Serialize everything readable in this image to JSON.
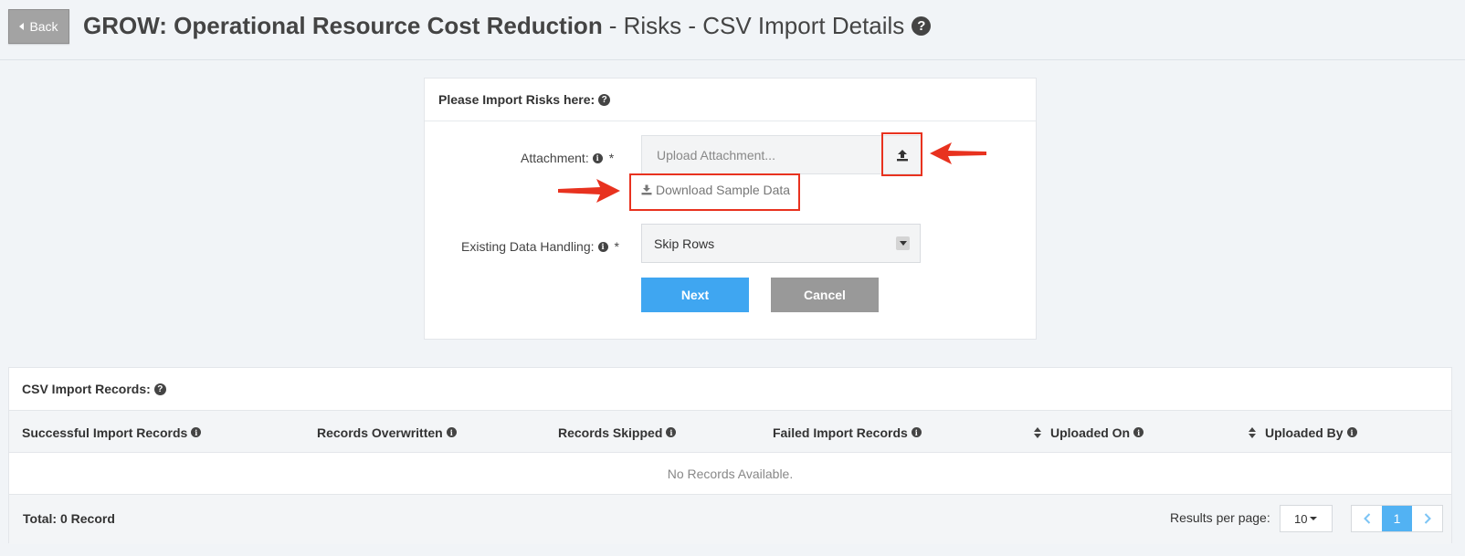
{
  "header": {
    "back_label": "Back",
    "title_strong": "GROW: Operational Resource Cost Reduction",
    "title_rest": "- Risks - CSV Import Details",
    "help_icon": "question-circle-icon"
  },
  "import_panel": {
    "heading": "Please Import Risks here:",
    "attachment_label": "Attachment:",
    "required_mark": "*",
    "upload_placeholder": "Upload Attachment...",
    "upload_icon": "upload-icon",
    "download_label": "Download Sample Data",
    "download_icon": "download-icon",
    "existing_data_label": "Existing Data Handling:",
    "existing_data_value": "Skip Rows",
    "next_label": "Next",
    "cancel_label": "Cancel"
  },
  "records": {
    "heading": "CSV Import Records:",
    "columns": [
      {
        "label": "Successful Import Records",
        "sortable": false
      },
      {
        "label": "Records Overwritten",
        "sortable": false
      },
      {
        "label": "Records Skipped",
        "sortable": false
      },
      {
        "label": "Failed Import Records",
        "sortable": false
      },
      {
        "label": "Uploaded On",
        "sortable": true
      },
      {
        "label": "Uploaded By",
        "sortable": true
      }
    ],
    "empty_message": "No Records Available.",
    "total": "Total: 0 Record",
    "results_per_page_label": "Results per page:",
    "results_per_page_value": "10",
    "pages": [
      "1"
    ],
    "current_page": "1"
  },
  "colors": {
    "primary_button": "#3fa6f1",
    "secondary_button": "#999999",
    "annotation_red": "#e8321f",
    "background": "#f1f4f7"
  }
}
